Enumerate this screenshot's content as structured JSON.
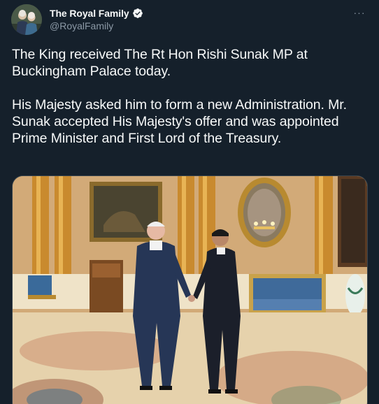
{
  "author": {
    "display_name": "The Royal Family",
    "handle": "@RoyalFamily",
    "verified": true,
    "avatar_icon": "avatar-photo"
  },
  "menu": {
    "more_icon": "more-options-icon",
    "glyph": "···"
  },
  "tweet": {
    "paragraphs": [
      "The King received The Rt Hon Rishi Sunak MP at Buckingham Palace today.",
      "His Majesty asked him to form a new Administration. Mr. Sunak accepted His Majesty's offer and was appointed Prime Minister and First Lord of the Treasury."
    ]
  },
  "media": {
    "type": "photo"
  },
  "colors": {
    "background": "#15202b",
    "text_primary": "#f7f9f9",
    "text_secondary": "#8b98a5",
    "verified_blue": "#1d9bf0"
  }
}
